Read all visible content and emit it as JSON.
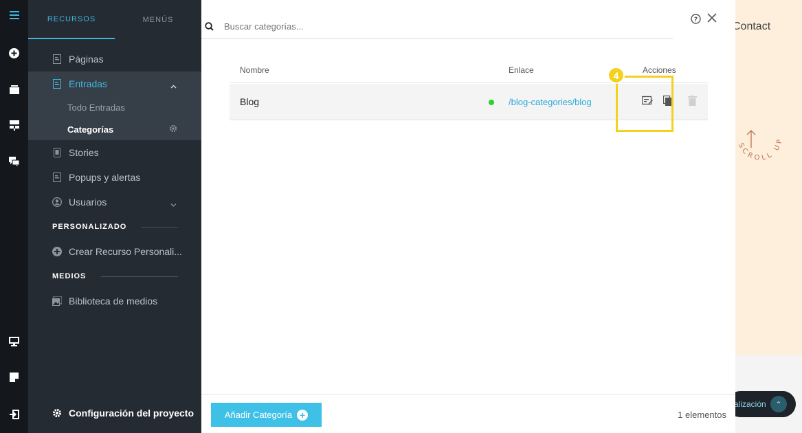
{
  "background_site": {
    "contact": "Contact",
    "scroll_text": "SCROLL UP",
    "pill_label": "alización"
  },
  "sidebar": {
    "tabs": [
      {
        "label": "RECURSOS"
      },
      {
        "label": "MENÚS"
      }
    ],
    "items": {
      "paginas": "Páginas",
      "entradas": "Entradas",
      "todo_entradas": "Todo Entradas",
      "categorias": "Categorías",
      "stories": "Stories",
      "popups": "Popups y alertas",
      "usuarios": "Usuarios"
    },
    "section_personalizado": "PERSONALIZADO",
    "crear_recurso": "Crear Recurso Personali...",
    "section_medios": "MEDIOS",
    "biblioteca": "Biblioteca de medios",
    "config": "Configuración del proyecto"
  },
  "search": {
    "placeholder": "Buscar categorías..."
  },
  "table": {
    "headers": {
      "nombre": "Nombre",
      "enlace": "Enlace",
      "acciones": "Acciones"
    },
    "rows": [
      {
        "name": "Blog",
        "link": "/blog-categories/blog",
        "status_color": "#2bd02b"
      }
    ]
  },
  "highlight": {
    "step": "4",
    "color": "#f3d11f"
  },
  "footer": {
    "add_button": "Añadir Categoría",
    "count": "1 elementos"
  },
  "colors": {
    "accent": "#3fb8e0",
    "button": "#3fc0e6",
    "sidebar_bg": "#252b33",
    "rail_bg": "#14181d"
  }
}
